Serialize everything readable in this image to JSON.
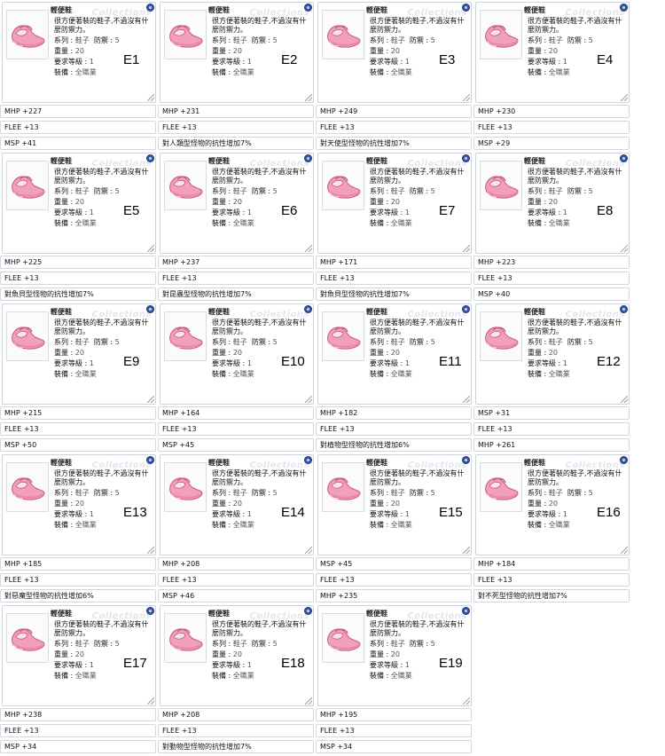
{
  "item": {
    "name": "輕便鞋",
    "desc": "很方便著裝的鞋子,不過沒有什麼防禦力。",
    "type_key": "系列",
    "type_val": "鞋子",
    "def_key": "防禦",
    "def_val": "5",
    "weight_key": "重量",
    "weight_val": "20",
    "level_key": "要求等級",
    "level_val": "1",
    "job_key": "裝備",
    "job_val": "全職業",
    "watermark": "Collections",
    "icon": "pink-shoe-icon"
  },
  "cards": [
    {
      "label": "E1",
      "bonuses": [
        "MHP +227",
        "FLEE +13",
        "MSP +41"
      ]
    },
    {
      "label": "E2",
      "bonuses": [
        "MHP +231",
        "FLEE +13",
        "對人類型怪物的抗性增加7%"
      ]
    },
    {
      "label": "E3",
      "bonuses": [
        "MHP +249",
        "FLEE +13",
        "對天使型怪物的抗性增加7%"
      ]
    },
    {
      "label": "E4",
      "bonuses": [
        "MHP +230",
        "FLEE +13",
        "MSP +29"
      ]
    },
    {
      "label": "E5",
      "bonuses": [
        "MHP +225",
        "FLEE +13",
        "對魚貝型怪物的抗性增加7%"
      ]
    },
    {
      "label": "E6",
      "bonuses": [
        "MHP +237",
        "FLEE +13",
        "對昆蟲型怪物的抗性增加7%"
      ]
    },
    {
      "label": "E7",
      "bonuses": [
        "MHP +171",
        "FLEE +13",
        "對魚貝型怪物的抗性增加7%"
      ]
    },
    {
      "label": "E8",
      "bonuses": [
        "MHP +223",
        "FLEE +13",
        "MSP +40"
      ]
    },
    {
      "label": "E9",
      "bonuses": [
        "MHP +215",
        "FLEE +13",
        "MSP +50"
      ]
    },
    {
      "label": "E10",
      "bonuses": [
        "MHP +164",
        "FLEE +13",
        "MSP +45"
      ]
    },
    {
      "label": "E11",
      "bonuses": [
        "MHP +182",
        "FLEE +13",
        "對植物型怪物的抗性增加6%"
      ]
    },
    {
      "label": "E12",
      "bonuses": [
        "MSP +31",
        "FLEE +13",
        "MHP +261"
      ]
    },
    {
      "label": "E13",
      "bonuses": [
        "MHP +185",
        "FLEE +13",
        "對惡魔型怪物的抗性增加6%"
      ]
    },
    {
      "label": "E14",
      "bonuses": [
        "MHP +208",
        "FLEE +13",
        "MSP +46"
      ]
    },
    {
      "label": "E15",
      "bonuses": [
        "MSP +45",
        "FLEE +13",
        "MHP +235"
      ]
    },
    {
      "label": "E16",
      "bonuses": [
        "MHP +184",
        "FLEE +13",
        "對不死型怪物的抗性增加7%"
      ]
    },
    {
      "label": "E17",
      "bonuses": [
        "MHP +238",
        "FLEE +13",
        "MSP +34"
      ]
    },
    {
      "label": "E18",
      "bonuses": [
        "MHP +208",
        "FLEE +13",
        "對動物型怪物的抗性增加7%"
      ]
    },
    {
      "label": "E19",
      "bonuses": [
        "MHP +195",
        "FLEE +13",
        "MSP +34"
      ]
    }
  ]
}
